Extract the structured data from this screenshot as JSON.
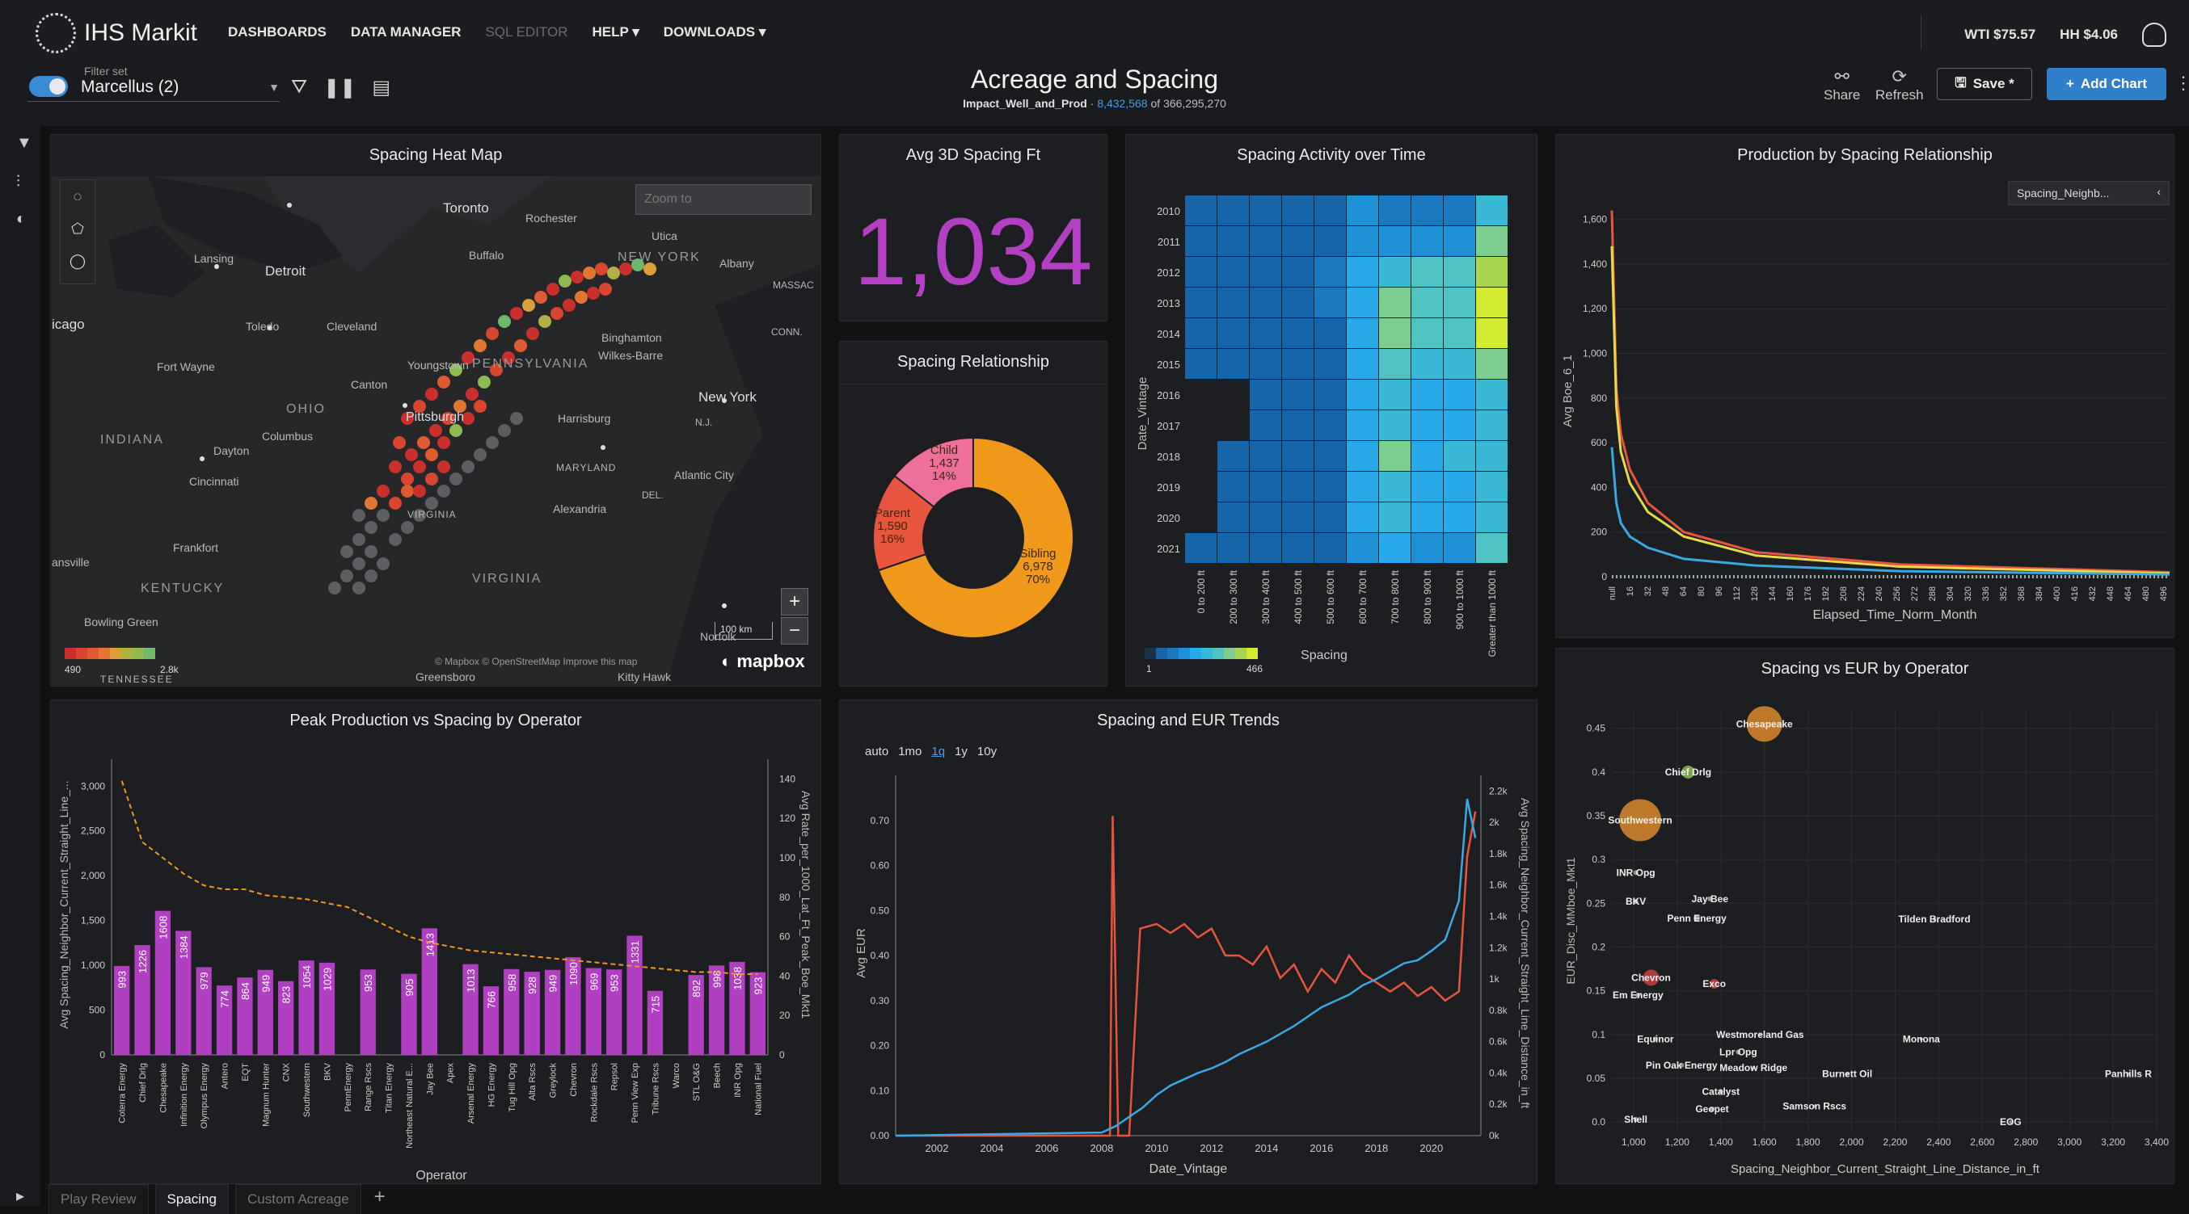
{
  "app": {
    "brand": "IHS Markit"
  },
  "nav": {
    "dashboards": "DASHBOARDS",
    "data_manager": "DATA MANAGER",
    "sql_editor": "SQL EDITOR",
    "help": "HELP ▾",
    "downloads": "DOWNLOADS ▾"
  },
  "prices": {
    "wti": "WTI $75.57",
    "hh": "HH $4.06"
  },
  "filter": {
    "label": "Filter set",
    "value": "Marcellus (2)"
  },
  "page": {
    "title": "Acreage and Spacing",
    "source": "Impact_Well_and_Prod",
    "sep": " · ",
    "count": "8,432,568",
    "of_total": " of 366,295,270"
  },
  "actions": {
    "share": "Share",
    "refresh": "Refresh",
    "save": "Save *",
    "add_chart": "Add Chart"
  },
  "tabs": {
    "play_review": "Play Review",
    "spacing": "Spacing",
    "custom_acreage": "Custom Acreage",
    "add": "+"
  },
  "heatmap_panel": {
    "title": "Spacing Heat Map",
    "zoom_placeholder": "Zoom to",
    "scale": "100 km",
    "attribution": "© Mapbox  © OpenStreetMap  Improve this map",
    "mapbox": "mapbox",
    "legend_min": "490",
    "legend_max": "2.8k",
    "legend_colors": [
      "#c9302c",
      "#d9452e",
      "#e05a2f",
      "#e27733",
      "#d9a03a",
      "#b0b044",
      "#8fba4f",
      "#6fba6a"
    ],
    "labels": {
      "toronto": "Toronto",
      "rochester": "Rochester",
      "utica": "Utica",
      "lansing": "Lansing",
      "detroit": "Detroit",
      "buffalo": "Buffalo",
      "new_york_state": "NEW YORK",
      "albany": "Albany",
      "massac": "MASSAC",
      "chicago": "icago",
      "toledo": "Toledo",
      "cleveland": "Cleveland",
      "binghamton": "Binghamton",
      "conn": "CONN.",
      "fort_wayne": "Fort Wayne",
      "youngstown": "Youngstown",
      "pennsylvania": "PENNSYLVANIA",
      "wilkes_barre": "Wilkes-Barre",
      "canton": "Canton",
      "new_york": "New York",
      "ohio": "OHIO",
      "pittsburgh": "Pittsburgh",
      "harrisburg": "Harrisburg",
      "nj": "N.J.",
      "indiana": "INDIANA",
      "columbus": "Columbus",
      "dayton": "Dayton",
      "maryland": "MARYLAND",
      "atlantic_city": "Atlantic City",
      "cincinnati": "Cincinnati",
      "del": "DEL.",
      "alexandria": "Alexandria",
      "virginia_w": "VIRGINIA",
      "frankfort": "Frankfort",
      "evansville": "ansville",
      "kentucky": "KENTUCKY",
      "virginia": "VIRGINIA",
      "bowling_green": "Bowling Green",
      "norfolk": "Norfolk",
      "greensboro": "Greensboro",
      "tennessee": "TENNESSEE",
      "kitty_hawk": "Kitty Hawk"
    }
  },
  "kpi_panel": {
    "title": "Avg 3D Spacing Ft",
    "value": "1,034"
  },
  "donut_panel": {
    "title": "Spacing Relationship",
    "chart_data": {
      "type": "pie",
      "slices": [
        {
          "name": "Sibling",
          "value": 6978,
          "label_value": "6,978",
          "pct": "70%",
          "color": "#f0981a"
        },
        {
          "name": "Parent",
          "value": 1590,
          "label_value": "1,590",
          "pct": "16%",
          "color": "#e8553f"
        },
        {
          "name": "Child",
          "value": 1437,
          "label_value": "1,437",
          "pct": "14%",
          "color": "#ef6e9a"
        }
      ]
    }
  },
  "activity_panel": {
    "title": "Spacing Activity over Time",
    "chart_data": {
      "type": "heatmap",
      "ylabel": "Date_Vintage",
      "xlabel": "Spacing",
      "rows": [
        "2010",
        "2011",
        "2012",
        "2013",
        "2014",
        "2015",
        "2016",
        "2017",
        "2018",
        "2019",
        "2020",
        "2021"
      ],
      "cols": [
        "0 to 200 ft",
        "200 to 300 ft",
        "300 to 400 ft",
        "400 to 500 ft",
        "500 to 600 ft",
        "600 to 700 ft",
        "700 to 800 ft",
        "800 to 900 ft",
        "900 to 1000 ft",
        "Greater than 1000 ft"
      ],
      "values": [
        [
          1,
          1,
          1,
          1,
          1,
          3,
          2,
          2,
          2,
          5
        ],
        [
          1,
          1,
          1,
          1,
          1,
          3,
          3,
          3,
          3,
          7
        ],
        [
          1,
          1,
          1,
          1,
          2,
          4,
          5,
          6,
          6,
          8
        ],
        [
          1,
          1,
          1,
          1,
          2,
          4,
          7,
          6,
          6,
          9
        ],
        [
          1,
          1,
          1,
          1,
          1,
          4,
          7,
          6,
          6,
          9
        ],
        [
          1,
          1,
          1,
          1,
          1,
          4,
          6,
          5,
          5,
          7
        ],
        [
          0,
          0,
          1,
          1,
          1,
          4,
          5,
          4,
          4,
          5
        ],
        [
          0,
          0,
          1,
          1,
          1,
          4,
          5,
          4,
          4,
          5
        ],
        [
          0,
          1,
          1,
          1,
          1,
          4,
          7,
          4,
          5,
          5
        ],
        [
          0,
          1,
          1,
          1,
          1,
          4,
          5,
          4,
          4,
          5
        ],
        [
          0,
          1,
          1,
          1,
          1,
          4,
          5,
          4,
          4,
          5
        ],
        [
          1,
          1,
          1,
          1,
          1,
          3,
          4,
          3,
          3,
          6
        ]
      ],
      "legend_min": "1",
      "legend_max": "466"
    }
  },
  "production_panel": {
    "title": "Production by Spacing Relationship",
    "legend_label": "Spacing_Neighb...",
    "chart_data": {
      "type": "line",
      "xlabel": "Elapsed_Time_Norm_Month",
      "ylabel": "Avg Boe_6_1",
      "ylim": [
        0,
        1700
      ],
      "yticks": [
        "0",
        "200",
        "400",
        "600",
        "800",
        "1,000",
        "1,200",
        "1,400",
        "1,600"
      ],
      "xticks": [
        "null",
        "16",
        "32",
        "48",
        "64",
        "80",
        "96",
        "112",
        "128",
        "144",
        "160",
        "176",
        "192",
        "208",
        "224",
        "240",
        "256",
        "272",
        "288",
        "304",
        "320",
        "336",
        "352",
        "368",
        "384",
        "400",
        "416",
        "432",
        "448",
        "464",
        "480",
        "496"
      ],
      "series": [
        {
          "color": "#e8553f",
          "x": [
            0,
            4,
            8,
            16,
            32,
            64,
            128,
            256,
            496
          ],
          "values": [
            1640,
            840,
            640,
            480,
            330,
            200,
            110,
            55,
            20
          ]
        },
        {
          "color": "#e9d94a",
          "x": [
            0,
            4,
            8,
            16,
            32,
            64,
            128,
            256,
            496
          ],
          "values": [
            1480,
            760,
            560,
            420,
            290,
            180,
            95,
            45,
            15
          ]
        },
        {
          "color": "#3aa8e3",
          "x": [
            0,
            4,
            8,
            16,
            32,
            64,
            128,
            256,
            496
          ],
          "values": [
            580,
            330,
            240,
            180,
            130,
            80,
            50,
            25,
            10
          ]
        }
      ]
    }
  },
  "peak_panel": {
    "title": "Peak Production vs Spacing by Operator",
    "chart_data": {
      "type": "bar",
      "xlabel": "Operator",
      "ylabel": "Avg Spacing_Neighbor_Current_Straight_Line_...",
      "y2label": "Avg Rate_per_1000_Lat_Ft_Peak_Boe_Mkt1",
      "ylim": [
        0,
        3300
      ],
      "yticks": [
        "0",
        "500",
        "1,000",
        "1,500",
        "2,000",
        "2,500",
        "3,000"
      ],
      "y2ticks": [
        "0",
        "20",
        "40",
        "60",
        "80",
        "100",
        "120",
        "140"
      ],
      "categories": [
        "Coterra Energy",
        "Chief Drlg",
        "Chesapeake",
        "Infinition Energy",
        "Olympus Energy",
        "Antero",
        "EQT",
        "Magnum Hunter",
        "CNX",
        "Southwestern",
        "BKV",
        "PennEnergy",
        "Range Rscs",
        "Titan Energy",
        "Northeast Natural E...",
        "Jay Bee",
        "Apex",
        "Arsenal Energy",
        "HG Energy",
        "Tug Hill Opg",
        "Alta Rscs",
        "Greylock",
        "Chevron",
        "Rockdale Rscs",
        "Repsol",
        "Penn View Exp",
        "Tribune Rscs",
        "Warco",
        "STL O&G",
        "Beech",
        "INR Opg",
        "National Fuel"
      ],
      "values": [
        993,
        1226,
        1608,
        1384,
        979,
        774,
        864,
        949,
        823,
        1054,
        1029,
        null,
        953,
        null,
        905,
        1413,
        null,
        1013,
        766,
        958,
        928,
        949,
        1090,
        969,
        953,
        1331,
        715,
        null,
        892,
        998,
        1038,
        923
      ],
      "line_values": [
        139,
        108,
        100,
        92,
        86,
        84,
        84,
        81,
        80,
        79,
        77,
        75,
        70,
        65,
        60,
        57,
        55,
        53,
        52,
        51,
        50,
        49,
        48,
        47,
        46,
        45,
        44,
        43,
        42,
        42,
        41,
        41
      ]
    }
  },
  "trends_panel": {
    "title": "Spacing and EUR Trends",
    "range_auto": "auto",
    "range_1mo": "1mo",
    "range_1q": "1q",
    "range_1y": "1y",
    "range_10y": "10y",
    "chart_data": {
      "type": "line",
      "xlabel": "Date_Vintage",
      "ylabel": "Avg EUR",
      "y2label": "Avg Spacing_Neighbor_Current_Straight_Line_Distance_in_ft",
      "ylim": [
        0,
        0.8
      ],
      "yticks": [
        "0.00",
        "0.10",
        "0.20",
        "0.30",
        "0.40",
        "0.50",
        "0.60",
        "0.70"
      ],
      "y2ticks": [
        "0k",
        "0.2k",
        "0.4k",
        "0.6k",
        "0.8k",
        "1k",
        "1.2k",
        "1.4k",
        "1.6k",
        "1.8k",
        "2k",
        "2.2k"
      ],
      "xticks": [
        "2002",
        "2004",
        "2006",
        "2008",
        "2010",
        "2012",
        "2014",
        "2016",
        "2018",
        "2020"
      ],
      "series": [
        {
          "name": "",
          "color": "#e8553f",
          "x": [
            2000.5,
            2008.3,
            2008.4,
            2008.6,
            2009.0,
            2009.4,
            2010.0,
            2010.5,
            2011.0,
            2011.5,
            2012.0,
            2012.5,
            2013.0,
            2013.5,
            2014.0,
            2014.5,
            2015.0,
            2015.5,
            2016.0,
            2016.5,
            2017.0,
            2017.5,
            2018.0,
            2018.5,
            2019.0,
            2019.5,
            2020.0,
            2020.5,
            2021.0,
            2021.3,
            2021.6
          ],
          "values": [
            0.0,
            0.0,
            0.71,
            0.0,
            0.0,
            0.46,
            0.47,
            0.45,
            0.47,
            0.44,
            0.46,
            0.4,
            0.4,
            0.38,
            0.42,
            0.35,
            0.38,
            0.32,
            0.37,
            0.34,
            0.4,
            0.36,
            0.34,
            0.32,
            0.34,
            0.31,
            0.33,
            0.3,
            0.32,
            0.62,
            0.72
          ]
        },
        {
          "name": "",
          "color": "#3aa8e3",
          "x": [
            2000.5,
            2008.0,
            2008.5,
            2009.0,
            2009.5,
            2010.0,
            2010.5,
            2011.0,
            2011.5,
            2012.0,
            2012.5,
            2013.0,
            2013.5,
            2014.0,
            2014.5,
            2015.0,
            2015.5,
            2016.0,
            2016.5,
            2017.0,
            2017.5,
            2018.0,
            2018.5,
            2019.0,
            2019.5,
            2020.0,
            2020.5,
            2021.0,
            2021.3,
            2021.6
          ],
          "values": [
            0,
            20,
            60,
            120,
            180,
            260,
            320,
            360,
            400,
            430,
            470,
            520,
            560,
            600,
            650,
            700,
            760,
            820,
            860,
            900,
            960,
            1000,
            1050,
            1100,
            1120,
            1180,
            1250,
            1500,
            2150,
            1900
          ]
        }
      ]
    }
  },
  "eur_panel": {
    "title": "Spacing vs EUR by Operator",
    "chart_data": {
      "type": "scatter",
      "xlabel": "Spacing_Neighbor_Current_Straight_Line_Distance_in_ft",
      "ylabel": "EUR_Disc_MMboe_Mkt1",
      "xlim": [
        900,
        3400
      ],
      "ylim": [
        -0.01,
        0.47
      ],
      "xticks": [
        "1,000",
        "1,200",
        "1,400",
        "1,600",
        "1,800",
        "2,000",
        "2,200",
        "2,400",
        "2,600",
        "2,800",
        "3,000",
        "3,200",
        "3,400"
      ],
      "yticks": [
        "0.0",
        "0.05",
        "0.1",
        "0.15",
        "0.2",
        "0.25",
        "0.3",
        "0.35",
        "0.4",
        "0.45"
      ],
      "points": [
        {
          "label": "Chesapeake",
          "x": 1600,
          "y": 0.455,
          "r": 22,
          "color": "#d98a2a"
        },
        {
          "label": "Chief Drlg",
          "x": 1250,
          "y": 0.4,
          "r": 8,
          "color": "#8fba4f"
        },
        {
          "label": "Southwestern",
          "x": 1030,
          "y": 0.345,
          "r": 26,
          "color": "#d98a2a"
        },
        {
          "label": "INR Opg",
          "x": 1010,
          "y": 0.285,
          "r": 3,
          "color": "#aaa"
        },
        {
          "label": "Jay Bee",
          "x": 1350,
          "y": 0.255,
          "r": 3,
          "color": "#aaa"
        },
        {
          "label": "BKV",
          "x": 1010,
          "y": 0.252,
          "r": 3,
          "color": "#aaa"
        },
        {
          "label": "Penn Energy",
          "x": 1290,
          "y": 0.233,
          "r": 4,
          "color": "#aaa"
        },
        {
          "label": "Tilden Bradford",
          "x": 2380,
          "y": 0.232,
          "r": 2,
          "color": "#aaa"
        },
        {
          "label": "Chevron",
          "x": 1080,
          "y": 0.165,
          "r": 10,
          "color": "#c94040"
        },
        {
          "label": "Exco",
          "x": 1370,
          "y": 0.158,
          "r": 6,
          "color": "#c94040"
        },
        {
          "label": "Em Energy",
          "x": 1020,
          "y": 0.145,
          "r": 3,
          "color": "#aaa"
        },
        {
          "label": "Westmoreland Gas",
          "x": 1580,
          "y": 0.1,
          "r": 2,
          "color": "#aaa"
        },
        {
          "label": "Equinor",
          "x": 1100,
          "y": 0.095,
          "r": 3,
          "color": "#aaa"
        },
        {
          "label": "Monona",
          "x": 2320,
          "y": 0.095,
          "r": 2,
          "color": "#aaa"
        },
        {
          "label": "Lpr Opg",
          "x": 1480,
          "y": 0.08,
          "r": 3,
          "color": "#aaa"
        },
        {
          "label": "Pin Oak Energy",
          "x": 1220,
          "y": 0.065,
          "r": 3,
          "color": "#aaa"
        },
        {
          "label": "Meadow Ridge",
          "x": 1550,
          "y": 0.062,
          "r": 2,
          "color": "#aaa"
        },
        {
          "label": "Burnett Oil",
          "x": 1980,
          "y": 0.055,
          "r": 2,
          "color": "#aaa"
        },
        {
          "label": "Panhills R",
          "x": 3270,
          "y": 0.055,
          "r": 2,
          "color": "#aaa"
        },
        {
          "label": "Catalyst",
          "x": 1400,
          "y": 0.035,
          "r": 3,
          "color": "#aaa"
        },
        {
          "label": "Geopet",
          "x": 1360,
          "y": 0.015,
          "r": 3,
          "color": "#aaa"
        },
        {
          "label": "Samson Rscs",
          "x": 1830,
          "y": 0.018,
          "r": 2,
          "color": "#aaa"
        },
        {
          "label": "Shell",
          "x": 1010,
          "y": 0.003,
          "r": 3,
          "color": "#aaa"
        },
        {
          "label": "EOG",
          "x": 2730,
          "y": 0.0,
          "r": 2,
          "color": "#aaa"
        }
      ]
    }
  }
}
